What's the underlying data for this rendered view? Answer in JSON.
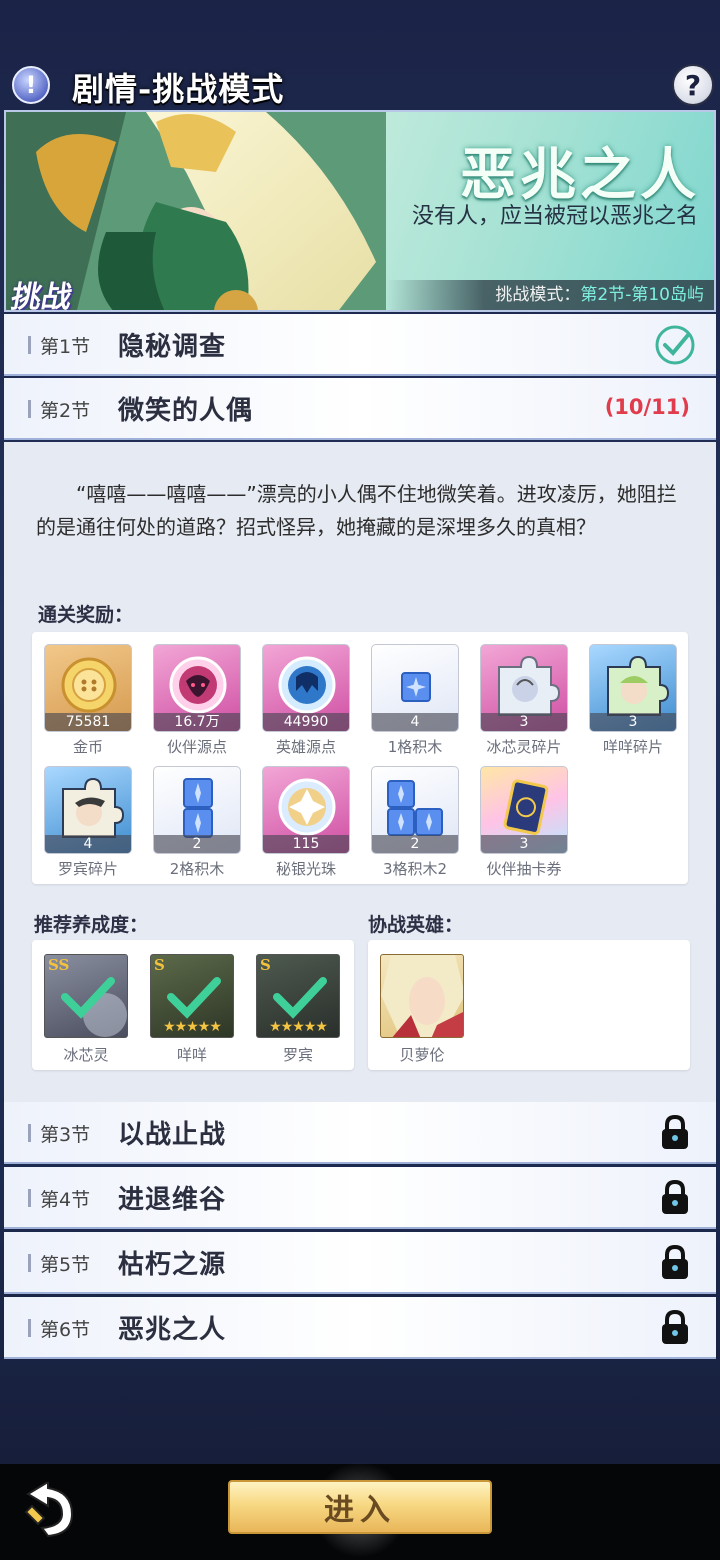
{
  "header": {
    "title": "剧情-挑战模式",
    "info_icon": "!",
    "help_icon": "?"
  },
  "banner": {
    "title": "恶兆之人",
    "subtitle": "没有人，应当被冠以恶兆之名",
    "badge": "挑战",
    "mode_label": "挑战模式：",
    "mode_range": "第2节-第10岛屿"
  },
  "sections": [
    {
      "num": "第1节",
      "name": "隐秘调查",
      "status": "completed"
    },
    {
      "num": "第2节",
      "name": "微笑的人偶",
      "progress": "(10/11)"
    },
    {
      "num": "第3节",
      "name": "以战止战",
      "status": "locked"
    },
    {
      "num": "第4节",
      "name": "进退维谷",
      "status": "locked"
    },
    {
      "num": "第5节",
      "name": "枯朽之源",
      "status": "locked"
    },
    {
      "num": "第6节",
      "name": "恶兆之人",
      "status": "locked"
    }
  ],
  "detail": {
    "description": "“嘻嘻——嘻嘻——”漂亮的小人偶不住地微笑着。进攻凌厉，她阻拦的是通往何处的道路？招式怪异，她掩藏的是深埋多久的真相？",
    "rewards_label": "通关奖励：",
    "rewards": [
      {
        "name": "金币",
        "count": "75581",
        "icon": "coin-icon"
      },
      {
        "name": "伙伴源点",
        "count": "16.7万",
        "icon": "partner-source-icon"
      },
      {
        "name": "英雄源点",
        "count": "44990",
        "icon": "hero-source-icon"
      },
      {
        "name": "1格积木",
        "count": "4",
        "icon": "block-1-icon"
      },
      {
        "name": "冰芯灵碎片",
        "count": "3",
        "icon": "puzzle-piece-icon"
      },
      {
        "name": "咩咩碎片",
        "count": "3",
        "icon": "puzzle-piece-icon"
      },
      {
        "name": "罗宾碎片",
        "count": "4",
        "icon": "puzzle-piece-icon"
      },
      {
        "name": "2格积木",
        "count": "2",
        "icon": "block-2-icon"
      },
      {
        "name": "秘银光珠",
        "count": "115",
        "icon": "mithril-orb-icon"
      },
      {
        "name": "3格积木2",
        "count": "2",
        "icon": "block-3-icon"
      },
      {
        "name": "伙伴抽卡券",
        "count": "3",
        "icon": "card-ticket-icon"
      }
    ],
    "recommend_label": "推荐养成度：",
    "recommend": [
      {
        "name": "冰芯灵",
        "grade": "SS",
        "checked": true
      },
      {
        "name": "咩咩",
        "grade": "S",
        "checked": true
      },
      {
        "name": "罗宾",
        "grade": "S",
        "checked": true
      }
    ],
    "assist_label": "协战英雄：",
    "assist": [
      {
        "name": "贝萝伦"
      }
    ]
  },
  "footer": {
    "enter_label": "进入"
  }
}
